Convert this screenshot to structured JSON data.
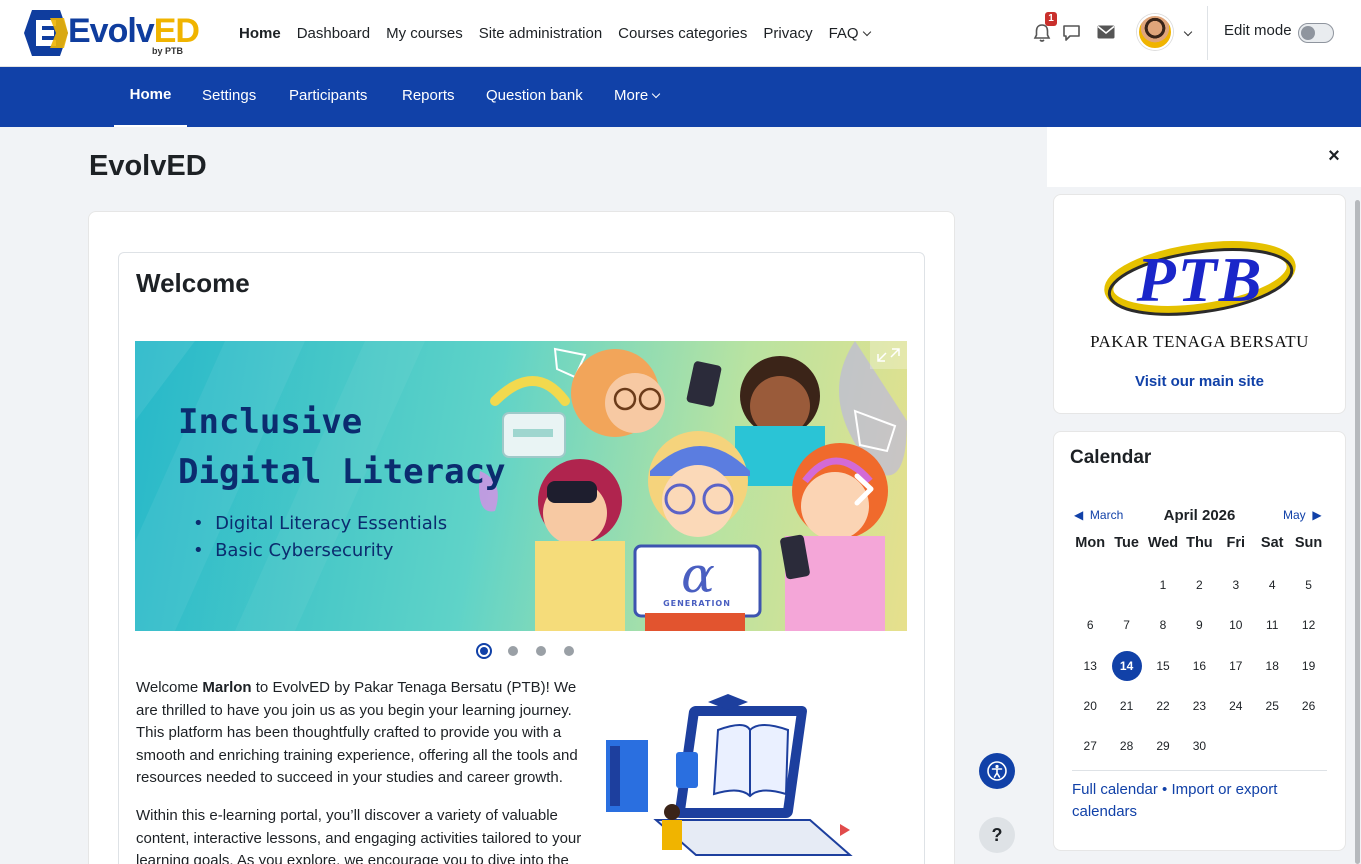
{
  "brand": {
    "logo_main": "Evolv",
    "logo_accent": "ED",
    "logo_sub": "by PTB"
  },
  "topnav": [
    {
      "label": "Home",
      "active": true
    },
    {
      "label": "Dashboard"
    },
    {
      "label": "My courses"
    },
    {
      "label": "Site administration"
    },
    {
      "label": "Courses categories"
    },
    {
      "label": "Privacy"
    },
    {
      "label": "FAQ",
      "dropdown": true
    }
  ],
  "user": {
    "notification_count": "1",
    "edit_mode_label": "Edit mode"
  },
  "secnav": [
    {
      "label": "Home",
      "active": true
    },
    {
      "label": "Settings"
    },
    {
      "label": "Participants"
    },
    {
      "label": "Reports"
    },
    {
      "label": "Question bank"
    },
    {
      "label": "More",
      "dropdown": true
    }
  ],
  "page": {
    "title": "EvolvED",
    "welcome_title": "Welcome"
  },
  "banner": {
    "heading_line1": "Inclusive",
    "heading_line2": "Digital Literacy",
    "bullets": [
      "Digital Literacy Essentials",
      "Basic Cybersecurity"
    ],
    "badge_symbol": "α",
    "badge_text": "GENERATION"
  },
  "carousel": {
    "slide_count": 4,
    "active_index": 0
  },
  "intro": {
    "p1_before": "Welcome ",
    "p1_name": "Marlon",
    "p1_after": " to EvolvED by Pakar Tenaga Bersatu (PTB)! We are thrilled to have you join us as you begin your learning journey. This platform has been thoughtfully crafted to provide you with a smooth and enriching training experience, offering all the tools and resources needed to succeed in your studies and career growth.",
    "p2": "Within this e-learning portal, you’ll discover a variety of valuable content, interactive lessons, and engaging activities tailored to your learning goals. As you explore, we encourage you to dive into the"
  },
  "help": {
    "label": "?"
  },
  "ptb_block": {
    "logo_text": "PTB",
    "company": "PAKAR TENAGA BERSATU",
    "link": "Visit our main site"
  },
  "calendar": {
    "title": "Calendar",
    "prev": "March",
    "month": "April 2026",
    "next": "May",
    "weekdays": [
      "Mon",
      "Tue",
      "Wed",
      "Thu",
      "Fri",
      "Sat",
      "Sun"
    ],
    "weeks": [
      [
        "",
        "",
        "1",
        "2",
        "3",
        "4",
        "5"
      ],
      [
        "6",
        "7",
        "8",
        "9",
        "10",
        "11",
        "12"
      ],
      [
        "13",
        "14",
        "15",
        "16",
        "17",
        "18",
        "19"
      ],
      [
        "20",
        "21",
        "22",
        "23",
        "24",
        "25",
        "26"
      ],
      [
        "27",
        "28",
        "29",
        "30",
        "",
        "",
        ""
      ]
    ],
    "today": "14",
    "footer_link1": "Full calendar",
    "footer_sep": " • ",
    "footer_link2": "Import or export calendars"
  },
  "colors": {
    "primary": "#1141a8",
    "accent": "#f0b400",
    "badge": "#c9302c"
  }
}
